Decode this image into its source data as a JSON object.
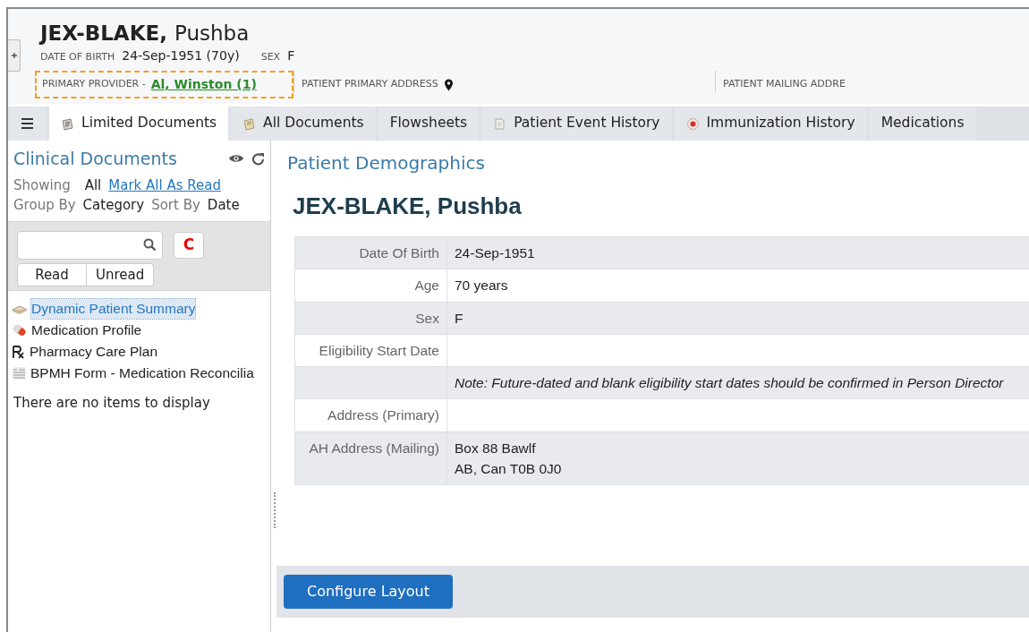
{
  "patient": {
    "surname": "JEX-BLAKE,",
    "given": "Pushba",
    "dob_label": "DATE OF BIRTH",
    "dob": "24-Sep-1951 (70y)",
    "sex_label": "SEX",
    "sex": "F"
  },
  "header_fields": [
    {
      "kind": "provider",
      "label": "PRIMARY PROVIDER -",
      "value": "Al, Winston (1)"
    },
    {
      "kind": "address",
      "label": "PATIENT PRIMARY ADDRESS"
    },
    {
      "kind": "plain",
      "label": "PATIENT MAILING ADDRE"
    }
  ],
  "tabs": [
    {
      "kind": "menu",
      "selected": false
    },
    {
      "kind": "notepad",
      "label": "Limited Documents",
      "selected": true
    },
    {
      "kind": "notepad-old",
      "label": "All Documents",
      "selected": false
    },
    {
      "kind": "plain",
      "label": "Flowsheets",
      "selected": false
    },
    {
      "kind": "page",
      "label": "Patient Event History",
      "selected": false
    },
    {
      "kind": "badge",
      "label": "Immunization History",
      "selected": false
    },
    {
      "kind": "plain",
      "label": "Medications",
      "selected": false
    }
  ],
  "sidebar": {
    "title": "Clinical Documents",
    "showing_label": "Showing",
    "showing_value": "All",
    "mark_all": "Mark All As Read",
    "group_label": "Group By",
    "group_value": "Category",
    "sort_label": "Sort By",
    "sort_value": "Date",
    "clear_button": "C",
    "filters": [
      "Read",
      "Unread"
    ],
    "documents": [
      {
        "kind": "book",
        "label": "Dynamic Patient Summary",
        "selected": true
      },
      {
        "kind": "pill",
        "label": "Medication Profile",
        "selected": false
      },
      {
        "kind": "rx",
        "label": "Pharmacy Care Plan",
        "selected": false
      },
      {
        "kind": "form",
        "label": "BPMH Form - Medication Reconcilia",
        "selected": false
      }
    ],
    "empty_message": "There are no items to display"
  },
  "main": {
    "section_title": "Patient Demographics",
    "patient_name": "JEX-BLAKE, Pushba",
    "rows": [
      {
        "kind": "field",
        "label": "Date Of Birth",
        "value": "24-Sep-1951"
      },
      {
        "kind": "field",
        "label": "Age",
        "value": "70 years"
      },
      {
        "kind": "field",
        "label": "Sex",
        "value": "F"
      },
      {
        "kind": "field",
        "label": "Eligibility Start Date"
      },
      {
        "kind": "note",
        "value": "Note: Future-dated and blank eligibility start dates should be confirmed in Person Director"
      },
      {
        "kind": "field",
        "label": "Address (Primary)"
      },
      {
        "kind": "multiline",
        "label": "AH Address (Mailing)",
        "lines": [
          "Box 88 Bawlf",
          "AB, Can T0B 0J0"
        ]
      }
    ],
    "configure_button": "Configure Layout"
  }
}
